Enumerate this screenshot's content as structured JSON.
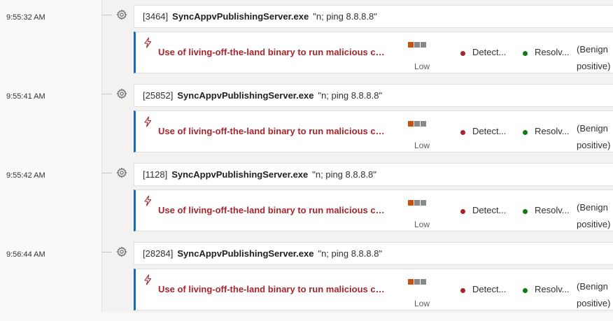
{
  "colors": {
    "alert_title": "#a4262c",
    "accent_border": "#0f6cbd",
    "severity_active": "#ca5010",
    "severity_inactive": "#8a8886",
    "detected_dot": "#a4262c",
    "resolved_dot": "#107c10"
  },
  "icons": {
    "process": "gear-icon",
    "alert": "lightning-bolt-icon"
  },
  "timeline": [
    {
      "time": "9:55:32 AM",
      "process": {
        "pid": "[3464]",
        "name": "SyncAppvPublishingServer.exe",
        "args": "\"n; ping 8.8.8.8\""
      },
      "alert": {
        "title": "Use of living-off-the-land binary to run malicious code",
        "severity": "Low",
        "severity_level": 1,
        "severity_max": 3,
        "status": "Detected",
        "status_display": "Detect...",
        "resolution": "Resolved",
        "resolution_display": "Resolv...",
        "classification_line1": "(Benign",
        "classification_line2": "positive)"
      }
    },
    {
      "time": "9:55:41 AM",
      "process": {
        "pid": "[25852]",
        "name": "SyncAppvPublishingServer.exe",
        "args": "\"n; ping 8.8.8.8\""
      },
      "alert": {
        "title": "Use of living-off-the-land binary to run malicious code",
        "severity": "Low",
        "severity_level": 1,
        "severity_max": 3,
        "status": "Detected",
        "status_display": "Detect...",
        "resolution": "Resolved",
        "resolution_display": "Resolv...",
        "classification_line1": "(Benign",
        "classification_line2": "positive)"
      }
    },
    {
      "time": "9:55:42 AM",
      "process": {
        "pid": "[1128]",
        "name": "SyncAppvPublishingServer.exe",
        "args": "\"n; ping 8.8.8.8\""
      },
      "alert": {
        "title": "Use of living-off-the-land binary to run malicious code",
        "severity": "Low",
        "severity_level": 1,
        "severity_max": 3,
        "status": "Detected",
        "status_display": "Detect...",
        "resolution": "Resolved",
        "resolution_display": "Resolv...",
        "classification_line1": "(Benign",
        "classification_line2": "positive)"
      }
    },
    {
      "time": "9:56:44 AM",
      "process": {
        "pid": "[28284]",
        "name": "SyncAppvPublishingServer.exe",
        "args": "\"n; ping 8.8.8.8\""
      },
      "alert": {
        "title": "Use of living-off-the-land binary to run malicious code",
        "severity": "Low",
        "severity_level": 1,
        "severity_max": 3,
        "status": "Detected",
        "status_display": "Detect...",
        "resolution": "Resolved",
        "resolution_display": "Resolv...",
        "classification_line1": "(Benign",
        "classification_line2": "positive)"
      }
    }
  ]
}
